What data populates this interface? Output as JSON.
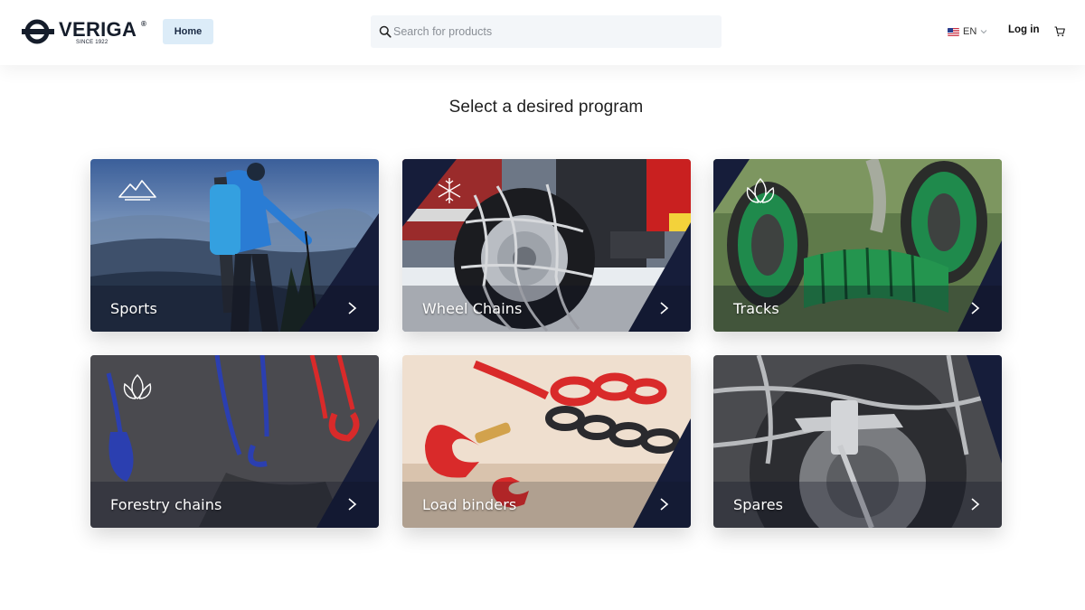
{
  "header": {
    "logo_text": "VERIGA",
    "logo_reg": "®",
    "logo_since": "SINCE 1922",
    "home_label": "Home",
    "search_placeholder": "Search for products",
    "lang_label": "EN",
    "login_label": "Log in"
  },
  "main": {
    "title": "Select a desired program",
    "cards": [
      {
        "label": "Sports",
        "icon": "mountain-icon"
      },
      {
        "label": "Wheel Chains",
        "icon": "snowflake-icon"
      },
      {
        "label": "Tracks",
        "icon": "leaf-icon"
      },
      {
        "label": "Forestry chains",
        "icon": "leaf-icon"
      },
      {
        "label": "Load binders",
        "icon": ""
      },
      {
        "label": "Spares",
        "icon": ""
      }
    ]
  },
  "colors": {
    "navy": "#161d3a",
    "home_bg": "#dcecf8",
    "search_bg": "#f3f6f9",
    "chain_green": "#1f8a4c",
    "chain_red": "#d92a2a",
    "chain_blue": "#2b3fb0"
  }
}
